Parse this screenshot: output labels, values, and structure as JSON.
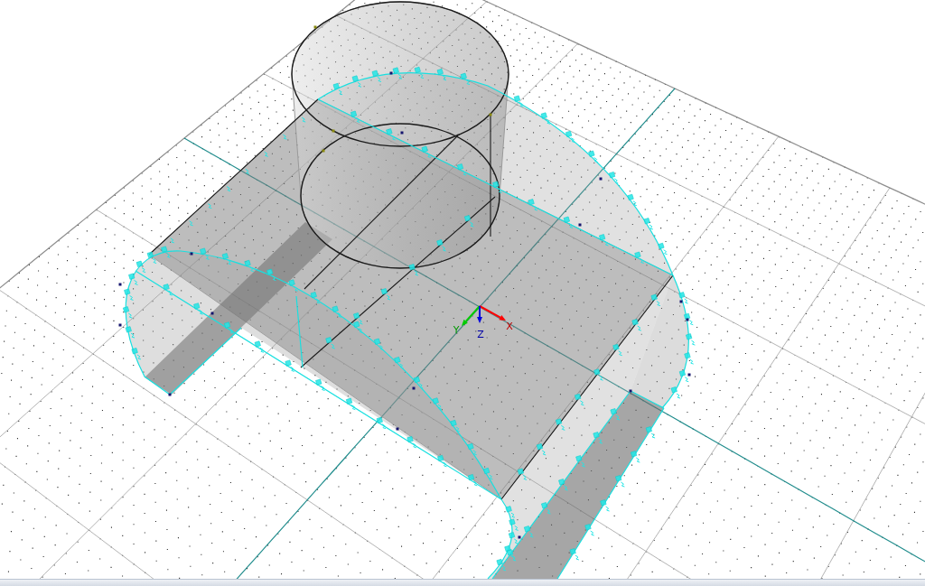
{
  "viewport": {
    "axes": [
      {
        "kind": "x",
        "label": "X",
        "color": "#ff0000"
      },
      {
        "kind": "y",
        "label": "Y",
        "color": "#00cc00"
      },
      {
        "kind": "z",
        "label": "Z",
        "color": "#0000dd"
      }
    ]
  }
}
